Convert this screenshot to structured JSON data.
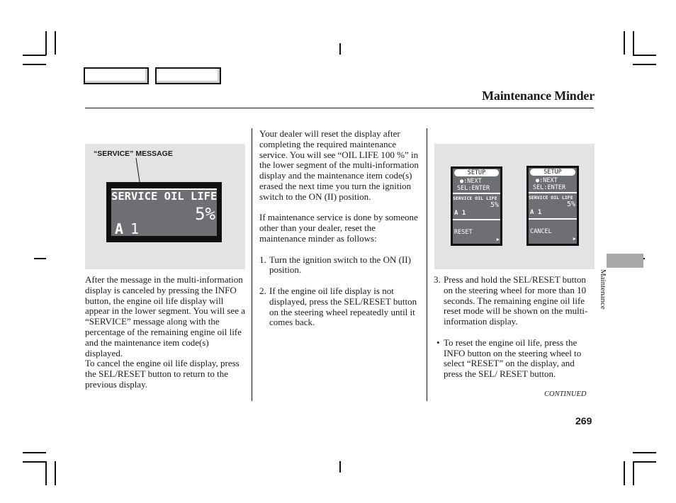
{
  "header": {
    "title": "Maintenance Minder",
    "tabs": [
      "",
      ""
    ]
  },
  "figure_left": {
    "callout_label": "“SERVICE” MESSAGE",
    "display": {
      "line1": "SERVICE OIL LIFE",
      "percent": "5%",
      "code_letter": "A",
      "code_number": "1"
    }
  },
  "figure_right": {
    "displays": [
      {
        "setup": "SETUP",
        "next": ":NEXT",
        "enter": "SEL:ENTER",
        "line1": "SERVICE OIL LIFE",
        "percent": "5%",
        "code": "A 1",
        "option": "RESET"
      },
      {
        "setup": "SETUP",
        "next": ":NEXT",
        "enter": "SEL:ENTER",
        "line1": "SERVICE OIL LIFE",
        "percent": "5%",
        "code": "A 1",
        "option": "CANCEL"
      }
    ],
    "info_icon": "info-icon"
  },
  "col1": {
    "para1": "After the message in the multi-information display is canceled by pressing the INFO button, the engine oil life display will appear in the lower segment. You will see a “SERVICE” message along with the percentage of the remaining engine oil life and the maintenance item code(s) displayed.",
    "para2": "To cancel the engine oil life display, press the SEL/RESET button to return to the previous display."
  },
  "col2": {
    "para1": "Your dealer will reset the display after completing the required maintenance service. You will see “OIL LIFE 100 %” in the lower segment of the multi-information display and the maintenance item code(s) erased the next time you turn the ignition switch to the ON (II) position.",
    "para2": "If maintenance service is done by someone other than your dealer, reset the maintenance minder as follows:",
    "steps": [
      {
        "num": "1.",
        "text": "Turn the ignition switch to the ON (II) position."
      },
      {
        "num": "2.",
        "text": "If the engine oil life display is not displayed, press the SEL/RESET button on the steering wheel repeatedly until it comes back."
      }
    ]
  },
  "col3": {
    "step3": {
      "num": "3.",
      "text": "Press and hold the SEL/RESET button on the steering wheel for more than 10 seconds. The remaining engine oil life reset mode will be shown on the multi-information display."
    },
    "bullet": {
      "mark": "•",
      "text": "To reset the engine oil life, press the INFO button on the steering wheel to select “RESET” on the display, and press the SEL/ RESET button."
    },
    "continued": "CONTINUED"
  },
  "side_tab": {
    "label": "Maintenance"
  },
  "footer": {
    "page_number": "269"
  }
}
